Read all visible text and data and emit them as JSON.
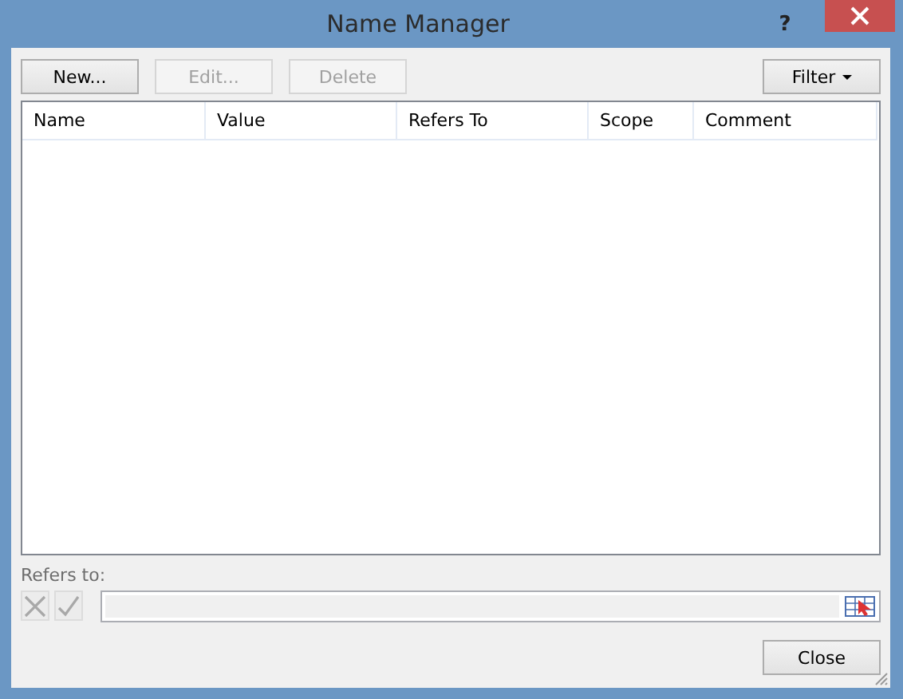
{
  "window": {
    "title": "Name Manager",
    "help": "?"
  },
  "toolbar": [
    {
      "label": "New...",
      "disabled": false
    },
    {
      "label": "Edit...",
      "disabled": true
    },
    {
      "label": "Delete",
      "disabled": true
    }
  ],
  "filter": {
    "label": "Filter",
    "disabled": false
  },
  "table": {
    "columns": [
      "Name",
      "Value",
      "Refers To",
      "Scope",
      "Comment"
    ]
  },
  "refers_to": {
    "label": "Refers to:",
    "disabled": true
  },
  "buttons": [
    "Close"
  ]
}
